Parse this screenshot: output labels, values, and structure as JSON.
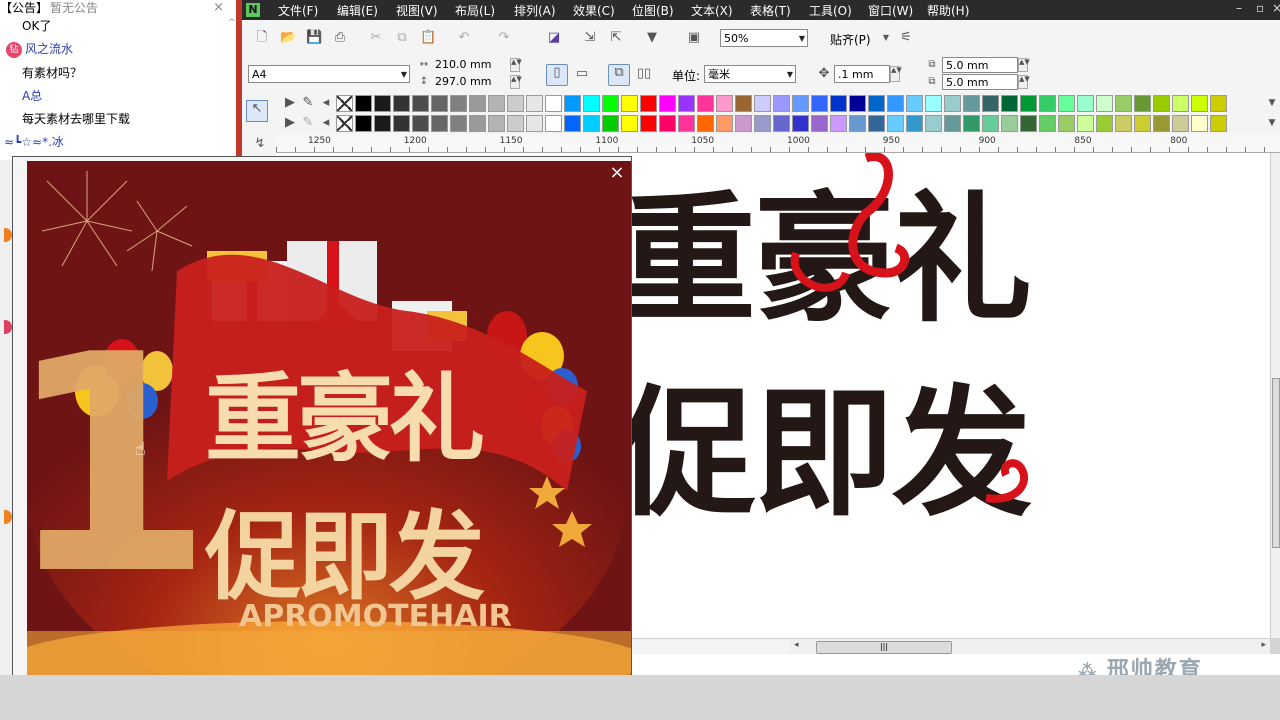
{
  "chat": {
    "notice_prefix": "【公告】",
    "notice_text": "暂无公告",
    "messages": [
      {
        "text": "OK了",
        "color": "#111"
      },
      {
        "text": "风之流水",
        "color": "#2a3fb0",
        "avatar": "钻"
      },
      {
        "text": "有素材吗？",
        "color": "#111"
      },
      {
        "text": "A总",
        "color": "#2a3fb0"
      },
      {
        "text": "每天素材去哪里下载",
        "color": "#111"
      },
      {
        "text": "≈┗☆≈*.冰",
        "color": "#2a3fb0"
      }
    ]
  },
  "menu": [
    "文件(F)",
    "编辑(E)",
    "视图(V)",
    "布局(L)",
    "排列(A)",
    "效果(C)",
    "位图(B)",
    "文本(X)",
    "表格(T)",
    "工具(O)",
    "窗口(W)",
    "帮助(H)"
  ],
  "toolbar": {
    "zoom": "50%",
    "snap": "贴齐(P)"
  },
  "propbar": {
    "page_size": "A4",
    "width": "210.0 mm",
    "height": "297.0 mm",
    "unit_label": "单位:",
    "unit_value": "毫米",
    "nudge": ".1 mm",
    "dup_x": "5.0 mm",
    "dup_y": "5.0 mm"
  },
  "palette": {
    "row1": [
      "#000000",
      "#1a1a1a",
      "#333333",
      "#4d4d4d",
      "#666666",
      "#808080",
      "#999999",
      "#b3b3b3",
      "#cccccc",
      "#e6e6e6",
      "#ffffff",
      "#0099ff",
      "#00ffff",
      "#00ff00",
      "#ffff00",
      "#ff0000",
      "#ff00ff",
      "#9933ff",
      "#ff3399",
      "#ff99cc",
      "#996633",
      "#ccccff",
      "#9999ff",
      "#6699ff",
      "#3366ff",
      "#0033cc",
      "#000099",
      "#0066cc",
      "#3399ff",
      "#66ccff",
      "#99ffff",
      "#99cccc",
      "#669999",
      "#336666",
      "#006633",
      "#009933",
      "#33cc66",
      "#66ff99",
      "#99ffcc",
      "#ccffcc",
      "#99cc66",
      "#669933",
      "#99cc00",
      "#ccff66",
      "#ccff00",
      "#cccc00"
    ],
    "row2": [
      "#000000",
      "#1a1a1a",
      "#333333",
      "#4d4d4d",
      "#666666",
      "#808080",
      "#999999",
      "#b3b3b3",
      "#cccccc",
      "#e6e6e6",
      "#ffffff",
      "#0066ff",
      "#00ccff",
      "#00cc00",
      "#ffff00",
      "#ff0000",
      "#ff0066",
      "#ff3399",
      "#ff6600",
      "#ff9966",
      "#cc99cc",
      "#9999cc",
      "#6666cc",
      "#3333cc",
      "#9966cc",
      "#cc99ff",
      "#6699cc",
      "#336699",
      "#66ccff",
      "#3399cc",
      "#99cccc",
      "#669999",
      "#339966",
      "#66cc99",
      "#99cc99",
      "#336633",
      "#66cc66",
      "#99cc66",
      "#ccff99",
      "#99cc33",
      "#cccc66",
      "#cccc33",
      "#999933",
      "#cccc99",
      "#ffffcc",
      "#cccc00"
    ]
  },
  "ruler": {
    "ticks": [
      {
        "label": "1250"
      },
      {
        "label": "1200"
      },
      {
        "label": "1150"
      },
      {
        "label": "1100"
      },
      {
        "label": "1050"
      },
      {
        "label": "1000"
      },
      {
        "label": "950"
      },
      {
        "label": "900"
      },
      {
        "label": "850"
      },
      {
        "label": "800"
      }
    ]
  },
  "canvas": {
    "line1": "重豪礼",
    "line2": "促即发"
  },
  "popup": {
    "close": "×",
    "title1": "重豪礼",
    "title2": "促即发",
    "subtitle": "APROMOTEHAIR",
    "big_digit": "1"
  },
  "watermark": "邢帅教育",
  "hscroll_grip": "|||"
}
